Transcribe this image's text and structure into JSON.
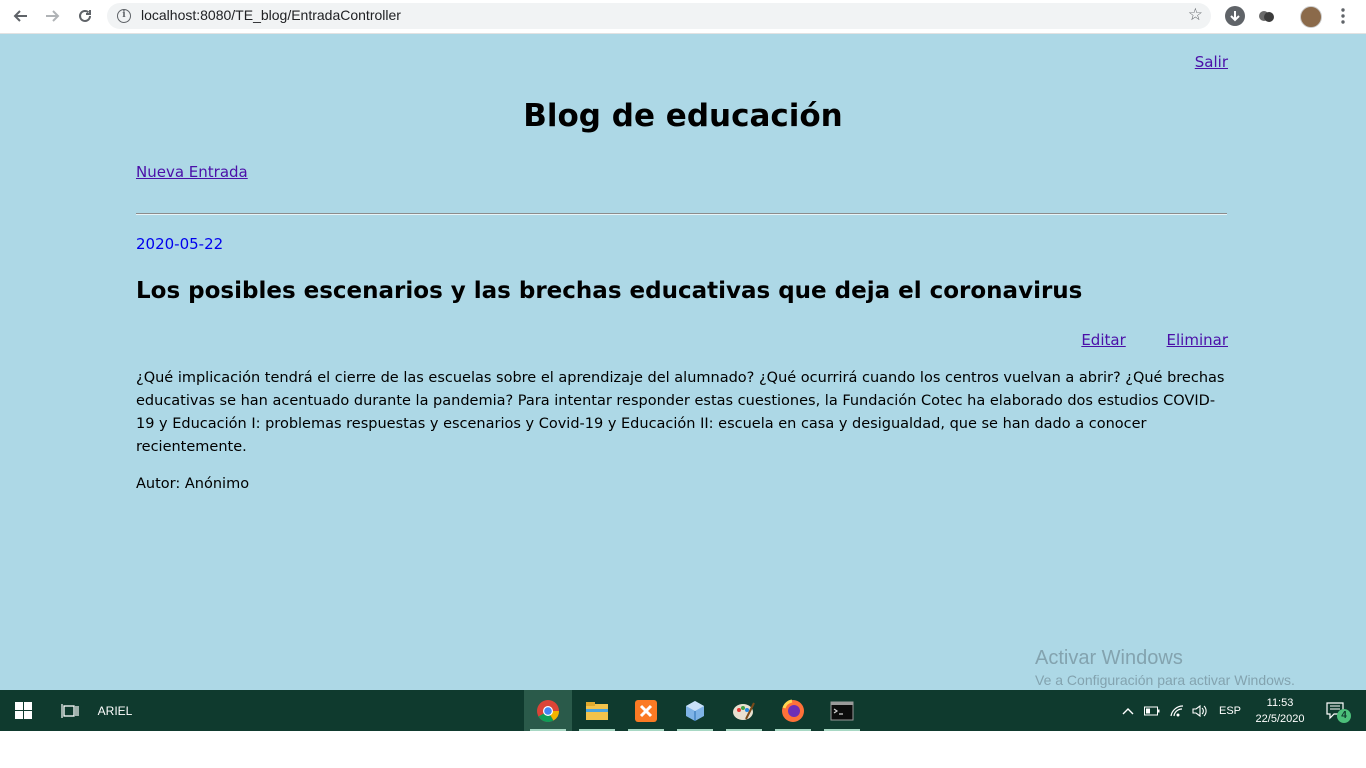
{
  "browser": {
    "url": "localhost:8080/TE_blog/EntradaController"
  },
  "page": {
    "logout_link": "Salir",
    "title": "Blog de educación",
    "new_entry_link": "Nueva Entrada",
    "post": {
      "date": "2020-05-22",
      "title": "Los posibles escenarios y las brechas educativas que deja el coronavirus",
      "edit_link": "Editar",
      "delete_link": "Eliminar",
      "body": "¿Qué implicación tendrá el cierre de las escuelas sobre el aprendizaje del alumnado? ¿Qué ocurrirá cuando los centros vuelvan a abrir? ¿Qué brechas educativas se han acentuado durante la pandemia? Para intentar responder estas cuestiones, la Fundación Cotec ha elaborado dos estudios COVID-19 y Educación I: problemas respuestas y escenarios y Covid-19 y Educación II: escuela en casa y desigualdad, que se han dado a conocer recientemente.",
      "author": "Autor: Anónimo"
    }
  },
  "watermark": {
    "line1": "Activar Windows",
    "line2": "Ve a Configuración para activar Windows."
  },
  "taskbar": {
    "user": "ARIEL",
    "language": "ESP",
    "time": "11:53",
    "date": "22/5/2020",
    "notification_count": "4",
    "apps": [
      "chrome-icon",
      "file-explorer-icon",
      "xampp-icon",
      "virtualbox-icon",
      "paint-icon",
      "firefox-icon",
      "terminal-icon"
    ]
  },
  "colors": {
    "page_background": "#add8e6",
    "link": "#4b0fa8",
    "date": "#0000ee",
    "taskbar": "#0f3a2e"
  }
}
